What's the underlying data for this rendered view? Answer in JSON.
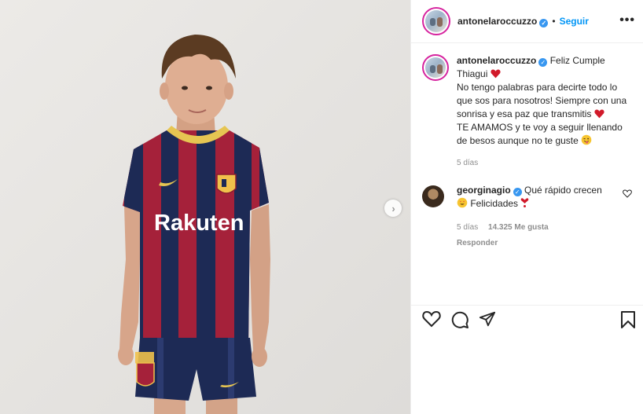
{
  "post": {
    "username": "antonelaroccuzzo",
    "follow_label": "Seguir",
    "dot": "•",
    "more_label": "•••",
    "next_label": "›",
    "caption": {
      "line1": "Feliz Cumple Thiagui",
      "para1": "No tengo palabras para decirte todo lo que sos para nosotros! Siempre con una sonrisa y esa paz que transmitis",
      "para2": "TE AMAMOS y te voy a seguir llenando de besos aunque no te guste",
      "time": "5 días"
    },
    "photo": {
      "shirt_sponsor": "Rakuten"
    },
    "comment": {
      "username": "georginagio",
      "text_part1": "Qué rápido crecen",
      "text_part2": "Felicidades",
      "time": "5 días",
      "likes": "14.325 Me gusta",
      "reply_label": "Responder"
    },
    "icons": [
      "heart-icon",
      "comment-icon",
      "share-icon",
      "bookmark-icon",
      "verified-icon",
      "more-icon"
    ],
    "colors": {
      "follow": "#0095f6",
      "verified": "#3897f0",
      "heart": "#ed4956"
    }
  }
}
